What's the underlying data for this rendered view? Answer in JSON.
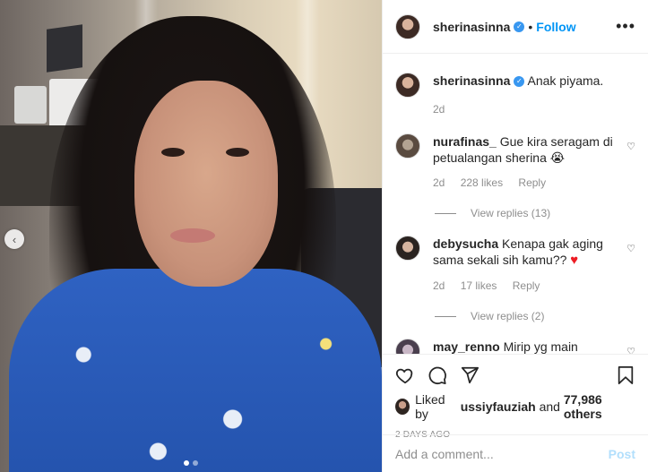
{
  "header": {
    "username": "sherinasinna",
    "separator": "•",
    "follow_label": "Follow",
    "more_icon": "more-horizontal-icon"
  },
  "caption": {
    "username": "sherinasinna",
    "text": "Anak piyama.",
    "time": "2d"
  },
  "comments": [
    {
      "username": "nurafinas_",
      "text": "Gue kira seragam di petualangan sherina",
      "emoji": "😭",
      "time": "2d",
      "likes": "228 likes",
      "reply_label": "Reply",
      "view_replies": "View replies (13)"
    },
    {
      "username": "debysucha",
      "text": "Kenapa gak aging sama sekali sih kamu??",
      "emoji": "♥",
      "time": "2d",
      "likes": "17 likes",
      "reply_label": "Reply",
      "view_replies": "View replies (2)"
    },
    {
      "username": "may_renno",
      "text": "Mirip yg main petualangan sherina ya.."
    }
  ],
  "actions": {
    "liked_prefix": "Liked by",
    "liked_user": "ussiyfauziah",
    "liked_and": "and",
    "liked_others": "77,986 others",
    "timestamp": "2 DAYS AGO"
  },
  "add_comment": {
    "placeholder": "Add a comment...",
    "post_label": "Post"
  },
  "colors": {
    "link_blue": "#0095f6",
    "verified_blue": "#3897f0",
    "muted": "#8e8e8e",
    "post_disabled": "#b2dffc",
    "heart_red": "#ed1c24"
  }
}
